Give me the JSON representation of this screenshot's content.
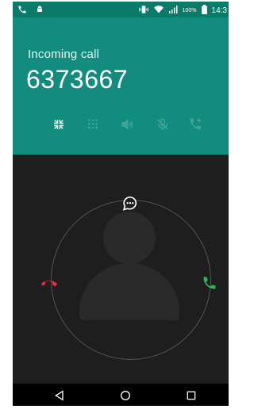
{
  "status_bar": {
    "battery_percent": "100%",
    "time": "14:3",
    "icons": [
      "phone-icon",
      "android-icon",
      "vibrate-icon",
      "wifi-icon",
      "signal-icon",
      "battery-icon"
    ]
  },
  "call": {
    "status_label": "Incoming call",
    "number": "6373667"
  },
  "controls": [
    {
      "name": "collapse-icon"
    },
    {
      "name": "dialpad-icon"
    },
    {
      "name": "speaker-icon"
    },
    {
      "name": "mute-icon"
    },
    {
      "name": "add-call-icon"
    }
  ],
  "colors": {
    "header": "#128c7e",
    "status_bar": "#0c7a69",
    "decline": "#e0304a",
    "answer": "#2fb45a",
    "background": "#1e1e1e"
  },
  "actions": {
    "message_icon": "message-icon",
    "decline_icon": "decline-call-icon",
    "answer_icon": "answer-call-icon"
  },
  "nav": [
    "back-icon",
    "home-icon",
    "recents-icon"
  ]
}
